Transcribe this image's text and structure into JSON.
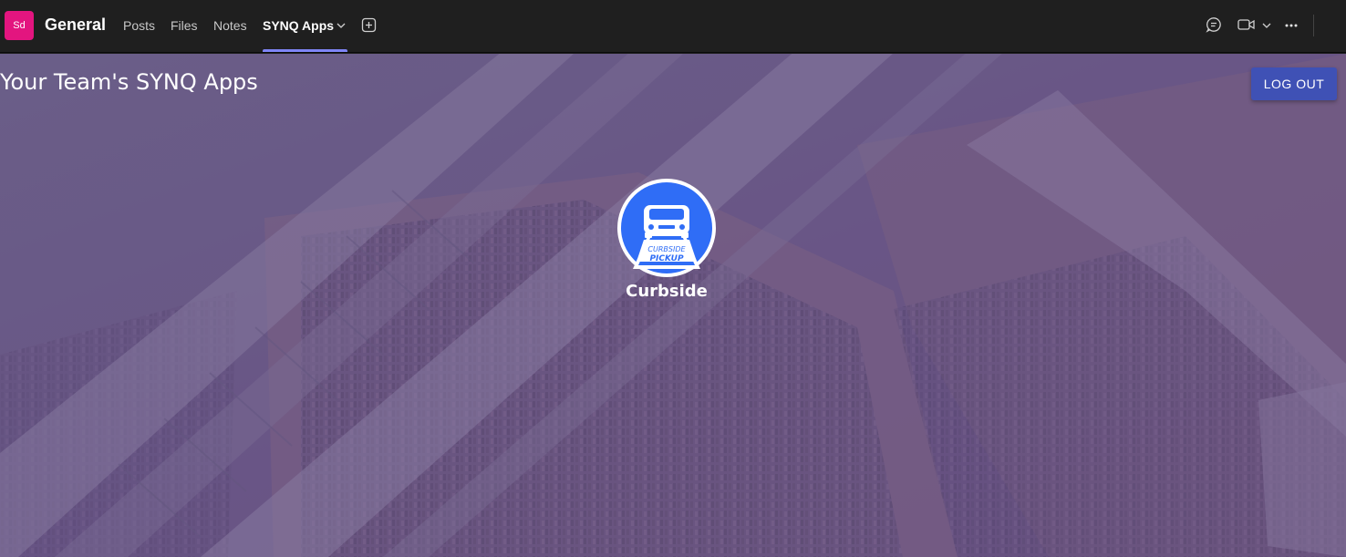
{
  "header": {
    "team_initials": "Sd",
    "channel_name": "General",
    "tabs": [
      {
        "label": "Posts",
        "active": false
      },
      {
        "label": "Files",
        "active": false
      },
      {
        "label": "Notes",
        "active": false
      },
      {
        "label": "SYNQ Apps",
        "active": true
      }
    ],
    "icons": [
      "add-tab-icon",
      "chat-icon",
      "video-call-icon",
      "chevron-down-icon",
      "more-options-icon"
    ]
  },
  "page": {
    "heading": "Your Team's SYNQ Apps",
    "logout_label": "LOG OUT"
  },
  "apps": [
    {
      "name": "Curbside",
      "icon_text_line1": "CURBSIDE",
      "icon_text_line2": "PICKUP"
    }
  ],
  "colors": {
    "team_avatar": "#e3157f",
    "active_tab_accent": "#7f85f5",
    "logout_button": "#3f51b5",
    "app_icon_fill": "#2f6df6",
    "background_tint": "#6e5a86"
  }
}
